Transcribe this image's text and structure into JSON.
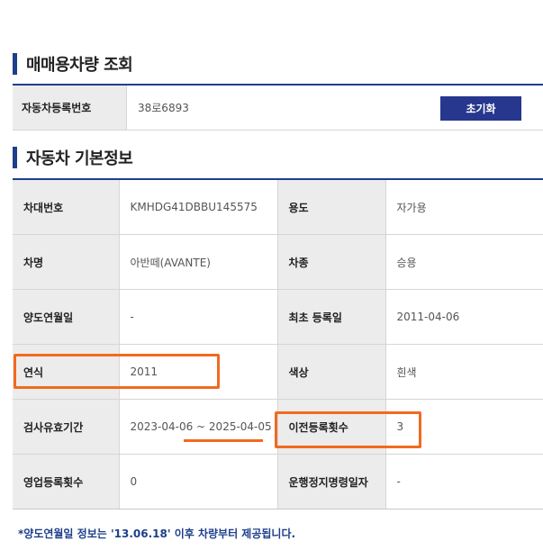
{
  "search_section": {
    "title": "매매용차량 조회",
    "reg_label": "자동차등록번호",
    "reg_value": "38로6893",
    "reset_label": "초기화"
  },
  "info_section": {
    "title": "자동차 기본정보",
    "rows": [
      [
        {
          "label": "차대번호",
          "value": "KMHDG41DBBU145575"
        },
        {
          "label": "용도",
          "value": "자가용"
        }
      ],
      [
        {
          "label": "차명",
          "value": "아반떼(AVANTE)"
        },
        {
          "label": "차종",
          "value": "승용"
        }
      ],
      [
        {
          "label": "양도연월일",
          "value": "-"
        },
        {
          "label": "최초 등록일",
          "value": "2011-04-06"
        }
      ],
      [
        {
          "label": "연식",
          "value": "2011"
        },
        {
          "label": "색상",
          "value": "흰색"
        }
      ],
      [
        {
          "label": "검사유효기간",
          "value": "2023-04-06 ~ 2025-04-05"
        },
        {
          "label": "이전등록횟수",
          "value": "3"
        }
      ],
      [
        {
          "label": "영업등록횟수",
          "value": "0"
        },
        {
          "label": "운행정지명령일자",
          "value": "-"
        }
      ]
    ]
  },
  "footnote": "*양도연월일 정보는 '13.06.18' 이후 차량부터 제공됩니다.",
  "colors": {
    "accent": "#1e3f8c",
    "button": "#26378d",
    "highlight": "#f26a1f",
    "label_bg": "#ececec"
  }
}
